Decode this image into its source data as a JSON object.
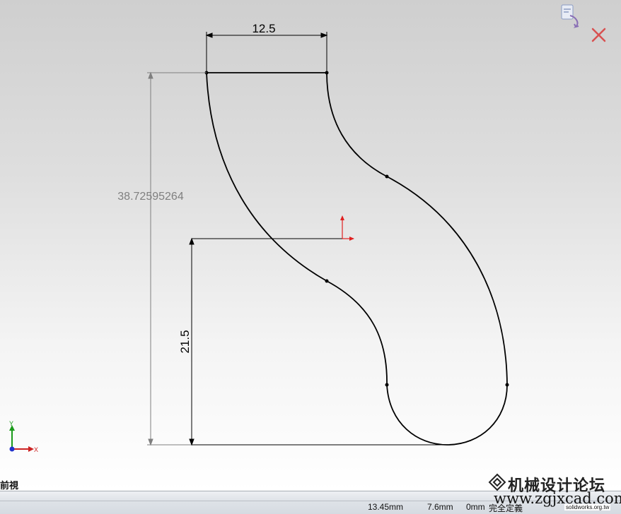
{
  "dimensions": {
    "width_dim": "12.5",
    "height_dim": "38.72595264",
    "offset_dim": "21.5"
  },
  "triad": {
    "y_label": "Y",
    "x_label": "X"
  },
  "view": {
    "label": "前視"
  },
  "status": {
    "x_coord": "13.45mm",
    "y_coord": "7.6mm",
    "z_coord": "0mm",
    "sketch_state": "完全定義"
  },
  "watermark": {
    "title": "机械设计论坛",
    "url": "www.zgjxcad.com",
    "small": "solidworks.org.tw"
  },
  "colors": {
    "sketch_line": "#000000",
    "dimension_line": "#000000",
    "driven_dimension": "#7f7f7f",
    "origin_red": "#e02020",
    "triad_green": "#1a9a1a",
    "triad_red": "#cc2222",
    "triad_blue": "#2233cc",
    "cancel_red": "#d85050"
  },
  "icons": [
    "confirm-corner-icon",
    "cancel-corner-icon",
    "sketch-origin-icon",
    "view-triad-icon"
  ]
}
